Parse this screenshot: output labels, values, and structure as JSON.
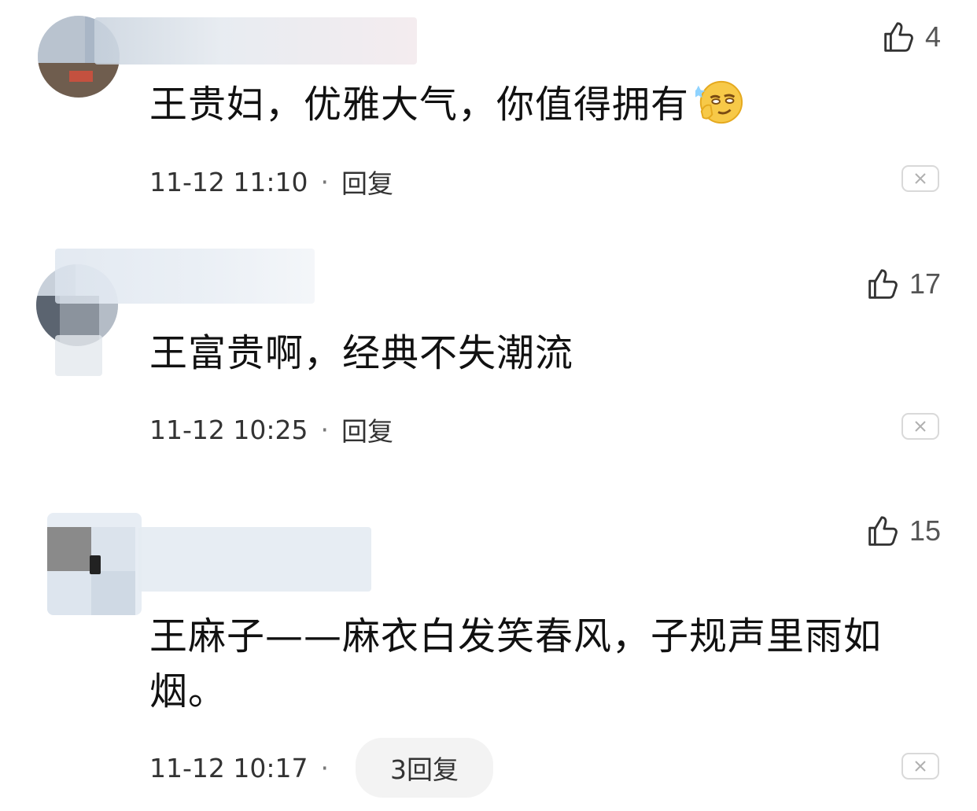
{
  "comments": [
    {
      "likes": "4",
      "text": "王贵妇，优雅大气，你值得拥有",
      "emoji": "smirk-emoji",
      "time": "11-12 11:10",
      "reply_label": "回复"
    },
    {
      "likes": "17",
      "text": "王富贵啊，经典不失潮流",
      "time": "11-12 10:25",
      "reply_label": "回复"
    },
    {
      "likes": "15",
      "text": "王麻子——麻衣白发笑春风，子规声里雨如烟。",
      "time": "11-12 10:17",
      "reply_label": "3回复"
    }
  ],
  "icons": {
    "like": "thumbs-up-icon",
    "close": "close-icon"
  },
  "colors": {
    "text": "#111111",
    "meta": "#333333",
    "pill_bg": "#f3f3f3",
    "border": "#d9d9d9"
  }
}
